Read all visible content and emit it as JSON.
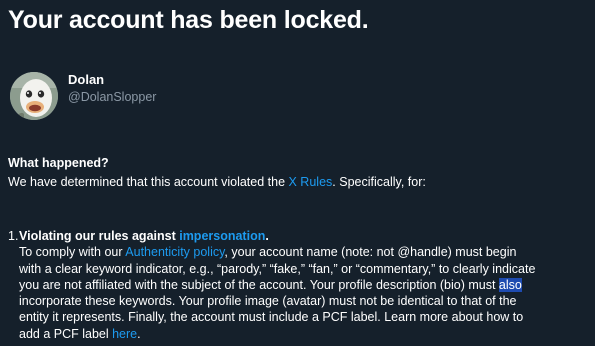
{
  "page": {
    "title": "Your account has been locked."
  },
  "profile": {
    "display_name": "Dolan",
    "handle": "@DolanSlopper",
    "avatar_icon": "duck-avatar"
  },
  "what_happened": {
    "heading": "What happened?",
    "text_before": "We have determined that this account violated the ",
    "rules_link": "X Rules",
    "text_after": ". Specifically, for:"
  },
  "violation": {
    "number": "1.",
    "heading_prefix": "Violating our rules against ",
    "heading_link": "impersonation",
    "heading_suffix": ".",
    "line1_before": "To comply with our ",
    "line1_link": "Authenticity policy",
    "line1_after": ", your account name (note: not @handle) must begin",
    "line2": "with a clear keyword indicator, e.g., “parody,” “fake,” “fan,” or “commentary,” to clearly indicate",
    "line3_before": "you are not affiliated with the subject of the account. Your profile description (bio) must ",
    "line3_highlight": "also",
    "line4": "incorporate these keywords. Your profile image (avatar) must not be identical to that of the",
    "line5": "entity it represents. Finally, the account must include a PCF label. Learn more about how to",
    "line6_before": "add a PCF label ",
    "line6_link": "here",
    "line6_after": "."
  },
  "colors": {
    "background": "#15202b",
    "text": "#ffffff",
    "link": "#1d9bf0",
    "muted": "#8b98a5",
    "selection": "#1e4bb0"
  }
}
